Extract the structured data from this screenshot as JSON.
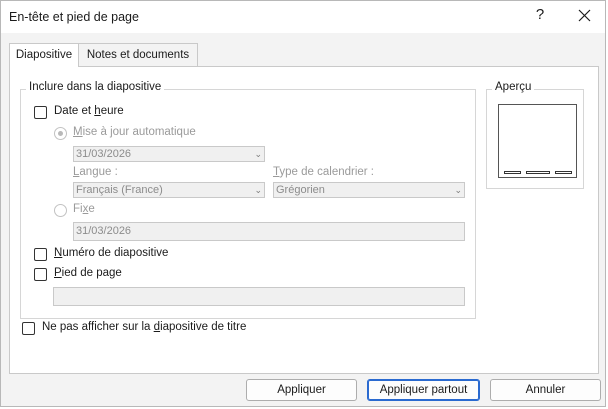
{
  "window": {
    "title": "En-tête et pied de page",
    "help_glyph": "?"
  },
  "tabs": [
    {
      "label": "Diapositive",
      "active": true
    },
    {
      "label": "Notes et documents",
      "active": false
    }
  ],
  "include_group": {
    "label": "Inclure dans la diapositive",
    "date_time": {
      "label_pre": "Date et ",
      "label_u": "h",
      "label_post": "eure",
      "checked": false
    },
    "auto_update": {
      "label_u": "M",
      "label_post": "ise à jour automatique",
      "selected": true
    },
    "date_value": "31/03/2026",
    "language": {
      "label_u": "L",
      "label_post": "angue :",
      "value": "Français (France)"
    },
    "calendar": {
      "label_u": "T",
      "label_post": "ype de calendrier :",
      "value": "Grégorien"
    },
    "fixed": {
      "label_pre": "Fi",
      "label_u": "x",
      "label_post": "e",
      "selected": false,
      "value": "31/03/2026"
    },
    "slide_number": {
      "label_u": "N",
      "label_post": "uméro de diapositive",
      "checked": false
    },
    "footer": {
      "label_u": "P",
      "label_post": "ied de page",
      "checked": false,
      "value": ""
    }
  },
  "dont_show_title": {
    "label_pre": "Ne pas afficher sur la ",
    "label_u": "d",
    "label_post": "iapositive de titre",
    "checked": false
  },
  "preview": {
    "label": "Aperçu"
  },
  "buttons": {
    "apply": "Appliquer",
    "apply_all": "Appliquer partout",
    "cancel": "Annuler"
  }
}
